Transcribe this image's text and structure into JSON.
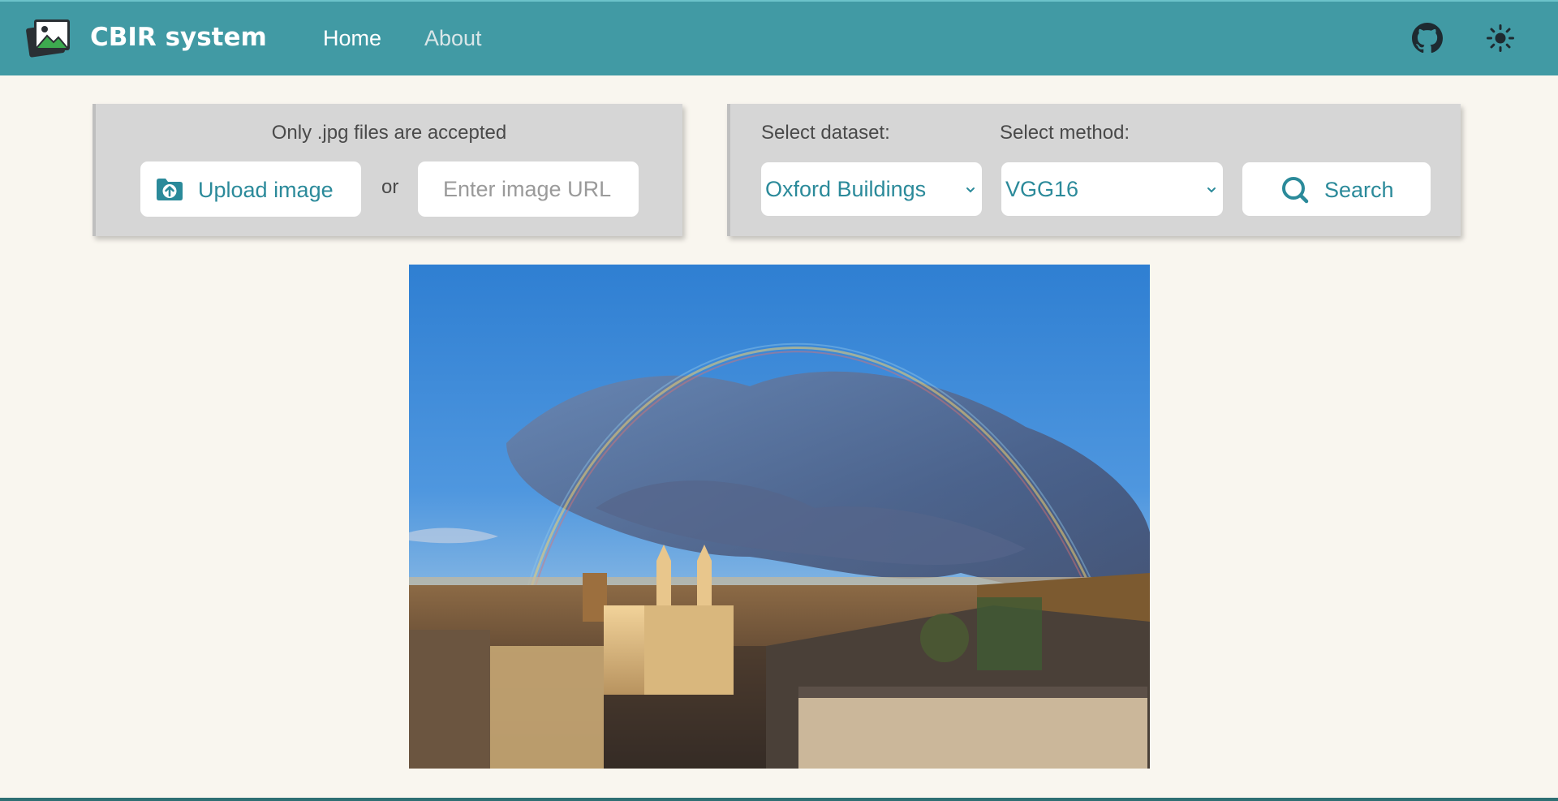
{
  "navbar": {
    "brand": "CBIR system",
    "links": [
      {
        "label": "Home",
        "active": true
      },
      {
        "label": "About",
        "active": false
      }
    ],
    "icons": [
      "image-logo-icon",
      "github-icon",
      "sun-icon"
    ],
    "background_color": "#419aa4"
  },
  "upload_panel": {
    "hint": "Only .jpg files are accepted",
    "upload_button_label": "Upload image",
    "or_text": "or",
    "url_placeholder": "Enter image URL",
    "url_value": ""
  },
  "search_panel": {
    "dataset_label": "Select dataset:",
    "dataset_selected": "Oxford Buildings",
    "method_label": "Select method:",
    "method_selected": "VGG16",
    "search_button_label": "Search",
    "accent_color": "#2b8a9a"
  },
  "preview": {
    "subject": "query image preview"
  }
}
